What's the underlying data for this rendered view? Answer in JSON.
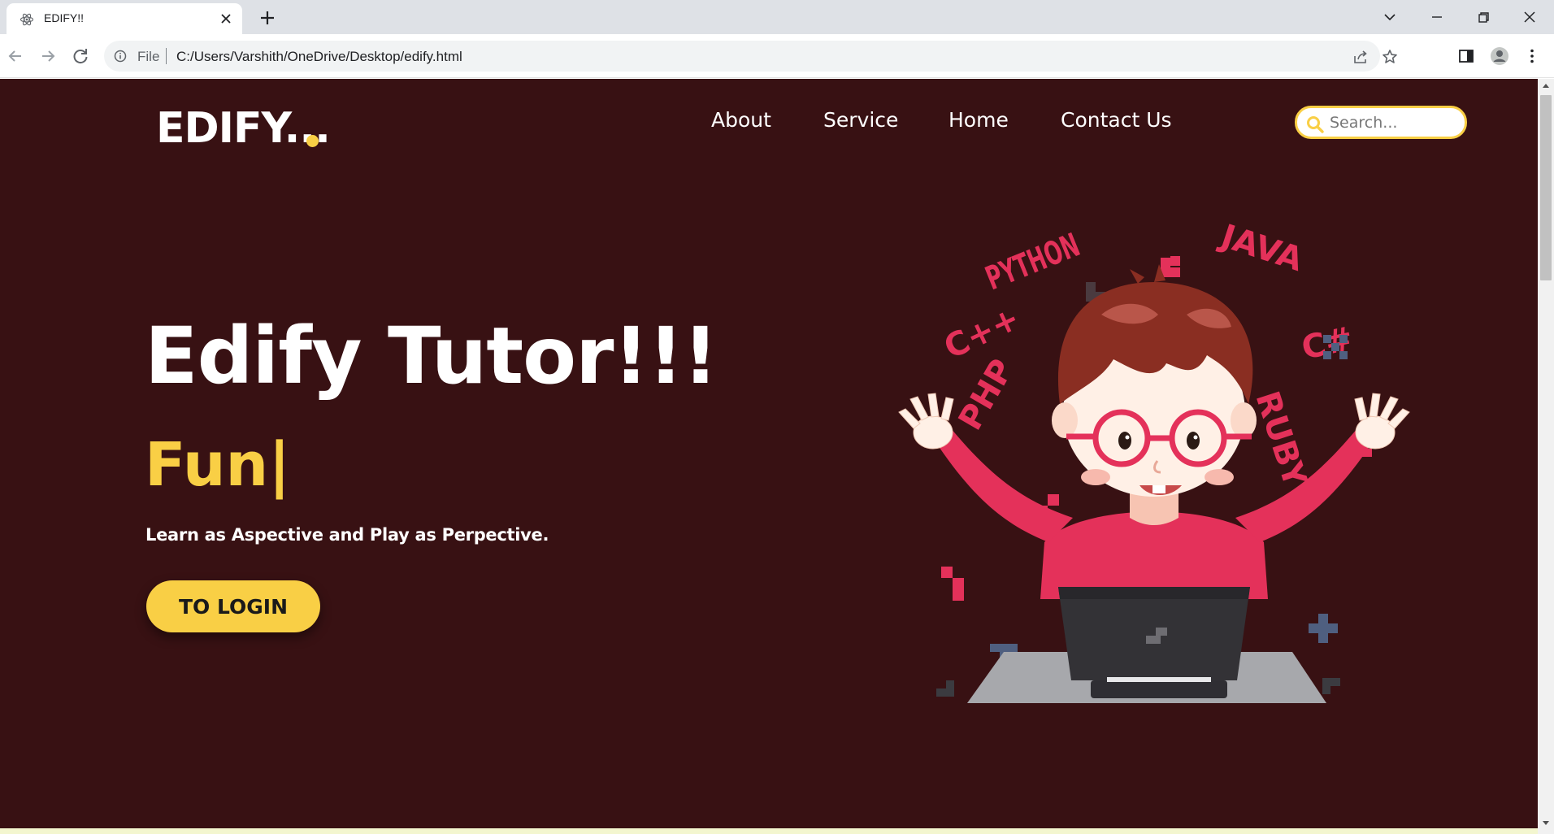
{
  "browser": {
    "tab_title": "EDIFY!!",
    "url_scheme": "File",
    "url": "C:/Users/Varshith/OneDrive/Desktop/edify.html"
  },
  "page": {
    "logo": "EDIFY...",
    "nav": [
      {
        "label": "About"
      },
      {
        "label": "Service"
      },
      {
        "label": "Home"
      },
      {
        "label": "Contact Us"
      }
    ],
    "search": {
      "placeholder": "Search...",
      "value": ""
    },
    "hero": {
      "title": "Edify Tutor!!!",
      "typed_text": "Fun|",
      "subtitle": "Learn as Aspective and Play as Perpective.",
      "cta_label": "TO LOGIN"
    },
    "illustration": {
      "labels": [
        "PYTHON",
        "JAVA",
        "C++",
        "C#",
        "PHP",
        "RUBY"
      ]
    }
  },
  "colors": {
    "background": "#381113",
    "accent": "#f9cf45",
    "text": "#ffffff",
    "illustration_red": "#e4315a"
  },
  "icons": {
    "tab": "atom-icon",
    "search": "search-icon"
  }
}
